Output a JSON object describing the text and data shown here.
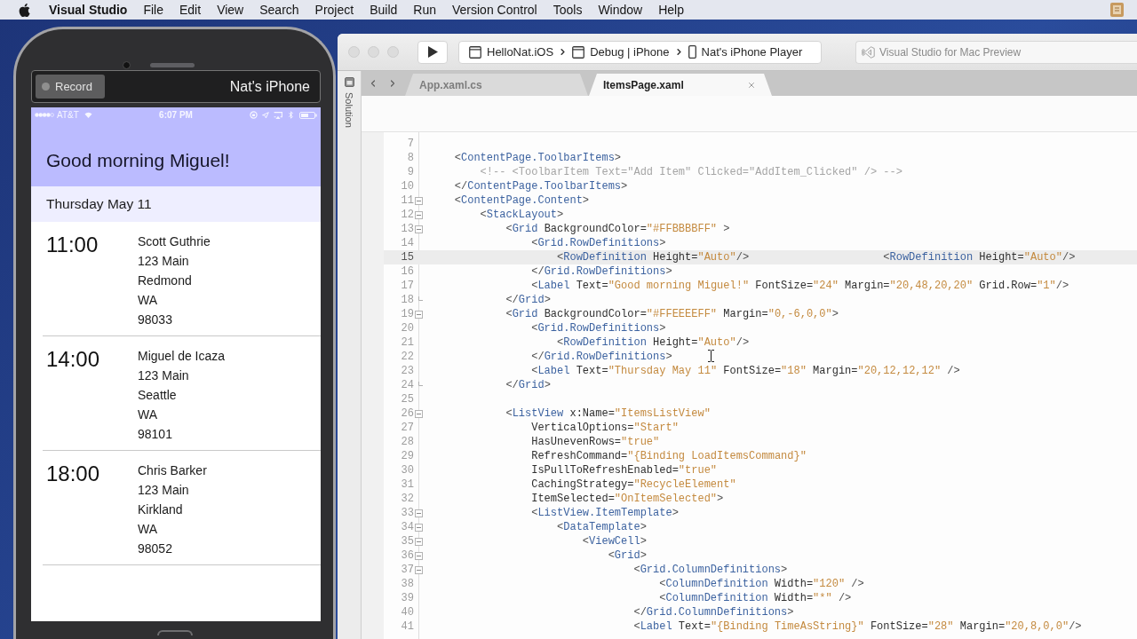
{
  "menu_bar": {
    "app_name": "Visual Studio",
    "items": [
      "File",
      "Edit",
      "View",
      "Search",
      "Project",
      "Build",
      "Run",
      "Version Control",
      "Tools",
      "Window",
      "Help"
    ]
  },
  "phone": {
    "record_button": "Record",
    "device_name": "Nat's iPhone",
    "status_bar": {
      "carrier": "AT&T",
      "time": "6:07 PM"
    },
    "title": "Good morning Miguel!",
    "date": "Thursday May 11",
    "appointments": [
      {
        "time": "11:00",
        "name": "Scott Guthrie",
        "street": "123 Main",
        "city": "Redmond",
        "state": "WA",
        "zip": "98033"
      },
      {
        "time": "14:00",
        "name": "Miguel de Icaza",
        "street": "123 Main",
        "city": "Seattle",
        "state": "WA",
        "zip": "98101"
      },
      {
        "time": "18:00",
        "name": "Chris Barker",
        "street": "123 Main",
        "city": "Kirkland",
        "state": "WA",
        "zip": "98052"
      }
    ]
  },
  "ide": {
    "toolbar": {
      "breadcrumb": [
        {
          "kind": "project",
          "label": "HelloNat.iOS"
        },
        {
          "kind": "configuration",
          "label": "Debug | iPhone"
        },
        {
          "kind": "device",
          "label": "Nat's iPhone Player"
        }
      ],
      "status": "Visual Studio for Mac Preview"
    },
    "sidebar": {
      "label": "Solution"
    },
    "tabs": [
      {
        "label": "App.xaml.cs",
        "selected": false
      },
      {
        "label": "ItemsPage.xaml",
        "selected": true
      }
    ],
    "editor": {
      "lines": [
        {
          "number": "7",
          "current": false,
          "foldable": false,
          "fold_end": false
        },
        {
          "number": "8",
          "current": false,
          "foldable": false,
          "fold_end": false,
          "segments": [
            {
              "kind": "punct",
              "text": "    <"
            },
            {
              "kind": "tag",
              "text": "ContentPage.ToolbarItems"
            },
            {
              "kind": "punct",
              "text": ">"
            }
          ]
        },
        {
          "number": "9",
          "current": false,
          "foldable": false,
          "fold_end": false,
          "segments": [
            {
              "kind": "comment",
              "text": "        <!-- <ToolbarItem Text=\"Add Item\" Clicked=\"AddItem_Clicked\" /> -->"
            }
          ]
        },
        {
          "number": "10",
          "current": false,
          "foldable": false,
          "fold_end": false,
          "segments": [
            {
              "kind": "punct",
              "text": "    </"
            },
            {
              "kind": "tag",
              "text": "ContentPage.ToolbarItems"
            },
            {
              "kind": "punct",
              "text": ">"
            }
          ]
        },
        {
          "number": "11",
          "current": false,
          "foldable": true,
          "fold_end": false,
          "segments": [
            {
              "kind": "punct",
              "text": "    <"
            },
            {
              "kind": "tag",
              "text": "ContentPage.Content"
            },
            {
              "kind": "punct",
              "text": ">"
            }
          ]
        },
        {
          "number": "12",
          "current": false,
          "foldable": true,
          "fold_end": false,
          "segments": [
            {
              "kind": "punct",
              "text": "        <"
            },
            {
              "kind": "tag",
              "text": "StackLayout"
            },
            {
              "kind": "punct",
              "text": ">"
            }
          ]
        },
        {
          "number": "13",
          "current": false,
          "foldable": true,
          "fold_end": false,
          "segments": [
            {
              "kind": "punct",
              "text": "            <"
            },
            {
              "kind": "tag",
              "text": "Grid"
            },
            {
              "kind": "attr",
              "text": " BackgroundColor="
            },
            {
              "kind": "value",
              "text": "\"#FFBBBBFF\""
            },
            {
              "kind": "punct",
              "text": " >"
            }
          ]
        },
        {
          "number": "14",
          "current": false,
          "foldable": false,
          "fold_end": false,
          "segments": [
            {
              "kind": "punct",
              "text": "                <"
            },
            {
              "kind": "tag",
              "text": "Grid.RowDefinitions"
            },
            {
              "kind": "punct",
              "text": ">"
            }
          ]
        },
        {
          "number": "15",
          "current": true,
          "foldable": false,
          "fold_end": false,
          "segments": [
            {
              "kind": "punct",
              "text": "                    <"
            },
            {
              "kind": "tag",
              "text": "RowDefinition"
            },
            {
              "kind": "attr",
              "text": " Height="
            },
            {
              "kind": "value",
              "text": "\"Auto\""
            },
            {
              "kind": "punct",
              "text": "/>                     <"
            },
            {
              "kind": "tag",
              "text": "RowDefinition"
            },
            {
              "kind": "attr",
              "text": " Height="
            },
            {
              "kind": "value",
              "text": "\"Auto\""
            },
            {
              "kind": "punct",
              "text": "/>"
            }
          ]
        },
        {
          "number": "16",
          "current": false,
          "foldable": false,
          "fold_end": false,
          "segments": [
            {
              "kind": "punct",
              "text": "                </"
            },
            {
              "kind": "tag",
              "text": "Grid.RowDefinitions"
            },
            {
              "kind": "punct",
              "text": ">"
            }
          ]
        },
        {
          "number": "17",
          "current": false,
          "foldable": false,
          "fold_end": false,
          "segments": [
            {
              "kind": "punct",
              "text": "                <"
            },
            {
              "kind": "tag",
              "text": "Label"
            },
            {
              "kind": "attr",
              "text": " Text="
            },
            {
              "kind": "value",
              "text": "\"Good morning Miguel!\""
            },
            {
              "kind": "attr",
              "text": " FontSize="
            },
            {
              "kind": "value",
              "text": "\"24\""
            },
            {
              "kind": "attr",
              "text": " Margin="
            },
            {
              "kind": "value",
              "text": "\"20,48,20,20\""
            },
            {
              "kind": "attr",
              "text": " Grid.Row="
            },
            {
              "kind": "value",
              "text": "\"1\""
            },
            {
              "kind": "punct",
              "text": "/>"
            }
          ]
        },
        {
          "number": "18",
          "current": false,
          "foldable": false,
          "fold_end": true,
          "segments": [
            {
              "kind": "punct",
              "text": "            </"
            },
            {
              "kind": "tag",
              "text": "Grid"
            },
            {
              "kind": "punct",
              "text": ">"
            }
          ]
        },
        {
          "number": "19",
          "current": false,
          "foldable": true,
          "fold_end": false,
          "segments": [
            {
              "kind": "punct",
              "text": "            <"
            },
            {
              "kind": "tag",
              "text": "Grid"
            },
            {
              "kind": "attr",
              "text": " BackgroundColor="
            },
            {
              "kind": "value",
              "text": "\"#FFEEEEFF\""
            },
            {
              "kind": "attr",
              "text": " Margin="
            },
            {
              "kind": "value",
              "text": "\"0,-6,0,0\""
            },
            {
              "kind": "punct",
              "text": ">"
            }
          ]
        },
        {
          "number": "20",
          "current": false,
          "foldable": false,
          "fold_end": false,
          "segments": [
            {
              "kind": "punct",
              "text": "                <"
            },
            {
              "kind": "tag",
              "text": "Grid.RowDefinitions"
            },
            {
              "kind": "punct",
              "text": ">"
            }
          ]
        },
        {
          "number": "21",
          "current": false,
          "foldable": false,
          "fold_end": false,
          "segments": [
            {
              "kind": "punct",
              "text": "                    <"
            },
            {
              "kind": "tag",
              "text": "RowDefinition"
            },
            {
              "kind": "attr",
              "text": " Height="
            },
            {
              "kind": "value",
              "text": "\"Auto\""
            },
            {
              "kind": "punct",
              "text": "/>"
            }
          ]
        },
        {
          "number": "22",
          "current": false,
          "foldable": false,
          "fold_end": false,
          "segments": [
            {
              "kind": "punct",
              "text": "                </"
            },
            {
              "kind": "tag",
              "text": "Grid.RowDefinitions"
            },
            {
              "kind": "punct",
              "text": ">"
            }
          ]
        },
        {
          "number": "23",
          "current": false,
          "foldable": false,
          "fold_end": false,
          "segments": [
            {
              "kind": "punct",
              "text": "                <"
            },
            {
              "kind": "tag",
              "text": "Label"
            },
            {
              "kind": "attr",
              "text": " Text="
            },
            {
              "kind": "value",
              "text": "\"Thursday May 11\""
            },
            {
              "kind": "attr",
              "text": " FontSize="
            },
            {
              "kind": "value",
              "text": "\"18\""
            },
            {
              "kind": "attr",
              "text": " Margin="
            },
            {
              "kind": "value",
              "text": "\"20,12,12,12\""
            },
            {
              "kind": "punct",
              "text": " />"
            }
          ]
        },
        {
          "number": "24",
          "current": false,
          "foldable": false,
          "fold_end": true,
          "segments": [
            {
              "kind": "punct",
              "text": "            </"
            },
            {
              "kind": "tag",
              "text": "Grid"
            },
            {
              "kind": "punct",
              "text": ">"
            }
          ]
        },
        {
          "number": "25",
          "current": false,
          "foldable": false,
          "fold_end": false
        },
        {
          "number": "26",
          "current": false,
          "foldable": true,
          "fold_end": false,
          "segments": [
            {
              "kind": "punct",
              "text": "            <"
            },
            {
              "kind": "tag",
              "text": "ListView"
            },
            {
              "kind": "attr",
              "text": " x:Name="
            },
            {
              "kind": "value",
              "text": "\"ItemsListView\""
            }
          ]
        },
        {
          "number": "27",
          "current": false,
          "foldable": false,
          "fold_end": false,
          "segments": [
            {
              "kind": "attr",
              "text": "                VerticalOptions="
            },
            {
              "kind": "value",
              "text": "\"Start\""
            }
          ]
        },
        {
          "number": "28",
          "current": false,
          "foldable": false,
          "fold_end": false,
          "segments": [
            {
              "kind": "attr",
              "text": "                HasUnevenRows="
            },
            {
              "kind": "value",
              "text": "\"true\""
            }
          ]
        },
        {
          "number": "29",
          "current": false,
          "foldable": false,
          "fold_end": false,
          "segments": [
            {
              "kind": "attr",
              "text": "                RefreshCommand="
            },
            {
              "kind": "value",
              "text": "\"{Binding LoadItemsCommand}\""
            }
          ]
        },
        {
          "number": "30",
          "current": false,
          "foldable": false,
          "fold_end": false,
          "segments": [
            {
              "kind": "attr",
              "text": "                IsPullToRefreshEnabled="
            },
            {
              "kind": "value",
              "text": "\"true\""
            }
          ]
        },
        {
          "number": "31",
          "current": false,
          "foldable": false,
          "fold_end": false,
          "segments": [
            {
              "kind": "attr",
              "text": "                CachingStrategy="
            },
            {
              "kind": "value",
              "text": "\"RecycleElement\""
            }
          ]
        },
        {
          "number": "32",
          "current": false,
          "foldable": false,
          "fold_end": false,
          "segments": [
            {
              "kind": "attr",
              "text": "                ItemSelected="
            },
            {
              "kind": "value",
              "text": "\"OnItemSelected\""
            },
            {
              "kind": "punct",
              "text": ">"
            }
          ]
        },
        {
          "number": "33",
          "current": false,
          "foldable": true,
          "fold_end": false,
          "segments": [
            {
              "kind": "punct",
              "text": "                <"
            },
            {
              "kind": "tag",
              "text": "ListView.ItemTemplate"
            },
            {
              "kind": "punct",
              "text": ">"
            }
          ]
        },
        {
          "number": "34",
          "current": false,
          "foldable": true,
          "fold_end": false,
          "segments": [
            {
              "kind": "punct",
              "text": "                    <"
            },
            {
              "kind": "tag",
              "text": "DataTemplate"
            },
            {
              "kind": "punct",
              "text": ">"
            }
          ]
        },
        {
          "number": "35",
          "current": false,
          "foldable": true,
          "fold_end": false,
          "segments": [
            {
              "kind": "punct",
              "text": "                        <"
            },
            {
              "kind": "tag",
              "text": "ViewCell"
            },
            {
              "kind": "punct",
              "text": ">"
            }
          ]
        },
        {
          "number": "36",
          "current": false,
          "foldable": true,
          "fold_end": false,
          "segments": [
            {
              "kind": "punct",
              "text": "                            <"
            },
            {
              "kind": "tag",
              "text": "Grid"
            },
            {
              "kind": "punct",
              "text": ">"
            }
          ]
        },
        {
          "number": "37",
          "current": false,
          "foldable": true,
          "fold_end": false,
          "segments": [
            {
              "kind": "punct",
              "text": "                                <"
            },
            {
              "kind": "tag",
              "text": "Grid.ColumnDefinitions"
            },
            {
              "kind": "punct",
              "text": ">"
            }
          ]
        },
        {
          "number": "38",
          "current": false,
          "foldable": false,
          "fold_end": false,
          "segments": [
            {
              "kind": "punct",
              "text": "                                    <"
            },
            {
              "kind": "tag",
              "text": "ColumnDefinition"
            },
            {
              "kind": "attr",
              "text": " Width="
            },
            {
              "kind": "value",
              "text": "\"120\""
            },
            {
              "kind": "punct",
              "text": " />"
            }
          ]
        },
        {
          "number": "39",
          "current": false,
          "foldable": false,
          "fold_end": false,
          "segments": [
            {
              "kind": "punct",
              "text": "                                    <"
            },
            {
              "kind": "tag",
              "text": "ColumnDefinition"
            },
            {
              "kind": "attr",
              "text": " Width="
            },
            {
              "kind": "value",
              "text": "\"*\""
            },
            {
              "kind": "punct",
              "text": " />"
            }
          ]
        },
        {
          "number": "40",
          "current": false,
          "foldable": false,
          "fold_end": false,
          "segments": [
            {
              "kind": "punct",
              "text": "                                </"
            },
            {
              "kind": "tag",
              "text": "Grid.ColumnDefinitions"
            },
            {
              "kind": "punct",
              "text": ">"
            }
          ]
        },
        {
          "number": "41",
          "current": false,
          "foldable": false,
          "fold_end": false,
          "segments": [
            {
              "kind": "punct",
              "text": "                                <"
            },
            {
              "kind": "tag",
              "text": "Label"
            },
            {
              "kind": "attr",
              "text": " Text="
            },
            {
              "kind": "value",
              "text": "\"{Binding TimeAsString}\""
            },
            {
              "kind": "attr",
              "text": " FontSize="
            },
            {
              "kind": "value",
              "text": "\"28\""
            },
            {
              "kind": "attr",
              "text": " Margin="
            },
            {
              "kind": "value",
              "text": "\"20,8,0,0\""
            },
            {
              "kind": "punct",
              "text": "/>"
            }
          ]
        }
      ]
    }
  }
}
